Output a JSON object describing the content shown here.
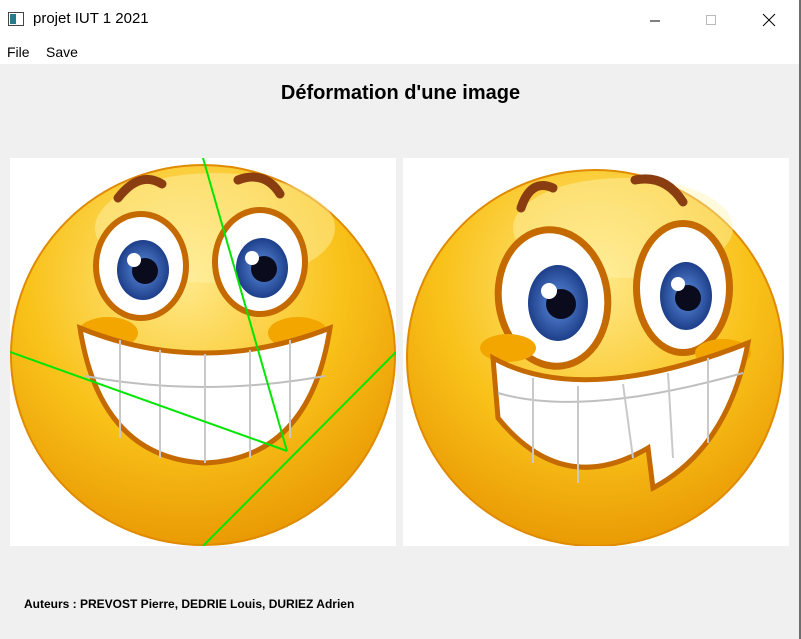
{
  "window": {
    "title": "projet IUT 1 2021"
  },
  "menu": {
    "file_label": "File",
    "save_label": "Save"
  },
  "main": {
    "heading": "Déformation d'une image",
    "authors": "Auteurs : PREVOST Pierre, DEDRIE Louis, DURIEZ Adrien"
  },
  "colors": {
    "guide_line": "#00e600",
    "smiley": "#f7b500",
    "iris": "#2f5fb5"
  }
}
